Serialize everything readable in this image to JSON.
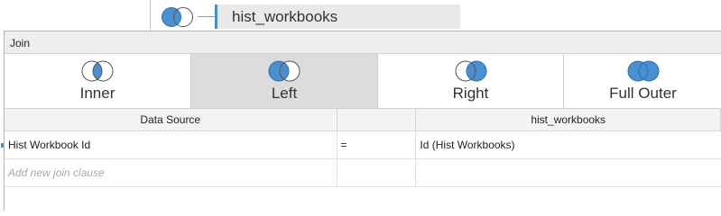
{
  "canvas": {
    "table_name": "hist_workbooks"
  },
  "dialog": {
    "title": "Join",
    "join_types": [
      {
        "label": "Inner",
        "icon": "inner-join-icon",
        "selected": false
      },
      {
        "label": "Left",
        "icon": "left-join-icon",
        "selected": true
      },
      {
        "label": "Right",
        "icon": "right-join-icon",
        "selected": false
      },
      {
        "label": "Full Outer",
        "icon": "full-outer-join-icon",
        "selected": false
      }
    ],
    "clause_table": {
      "headers": {
        "left": "Data Source",
        "operator": "",
        "right": "hist_workbooks"
      },
      "rows": [
        {
          "left": "Hist Workbook Id",
          "operator": "=",
          "right": "Id (Hist Workbooks)"
        }
      ],
      "add_clause_placeholder": "Add new join clause"
    }
  },
  "colors": {
    "venn_fill": "#4a8fd0",
    "venn_stroke": "#2f6fb0",
    "selected_background": "#dcdcdc",
    "accent": "#4a90c8"
  }
}
